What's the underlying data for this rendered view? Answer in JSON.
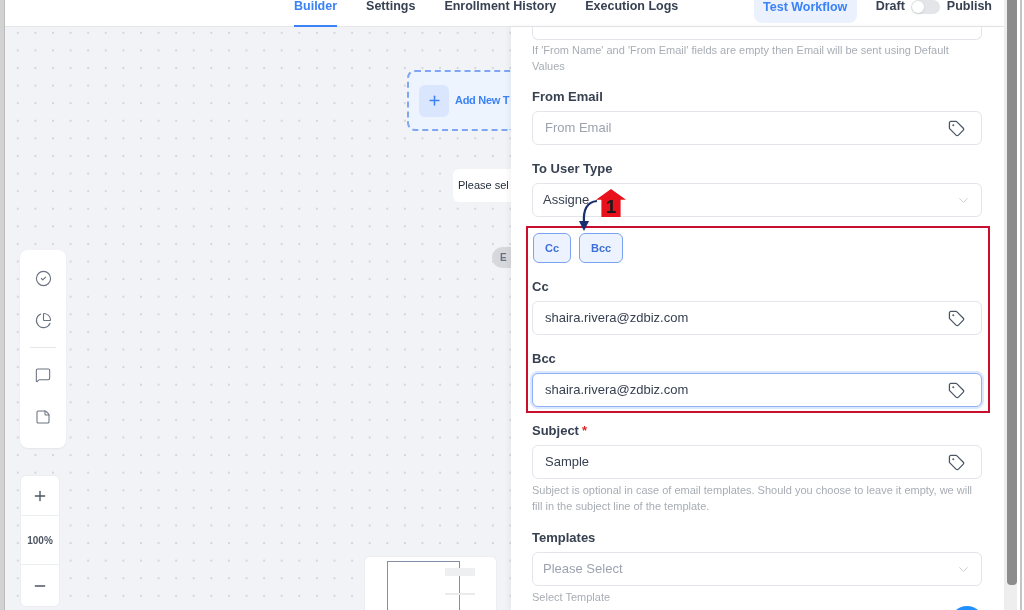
{
  "header": {
    "tabs": [
      {
        "label": "Builder",
        "selected": true
      },
      {
        "label": "Settings",
        "selected": false
      },
      {
        "label": "Enrollment History",
        "selected": false
      },
      {
        "label": "Execution Logs",
        "selected": false
      }
    ],
    "test_button": "Test Workflow",
    "status_switch": {
      "off_label": "Draft",
      "on_label": "Publish",
      "on": false
    }
  },
  "canvas": {
    "nodes": [
      {
        "kind": "add",
        "label": "Add New T"
      },
      {
        "kind": "trigger",
        "label": "Please sel"
      },
      {
        "kind": "end",
        "label": "E"
      }
    ],
    "zoom_level": "100%"
  },
  "panel": {
    "top_hint": "If 'From Name' and 'From Email' fields are empty then Email will be sent using Default Values",
    "fields": [
      {
        "kind": "text",
        "label": "From Email",
        "placeholder": "From Email",
        "focused": false,
        "highlighted": false
      },
      {
        "kind": "select",
        "label": "To User Type",
        "value": "Assigne",
        "highlighted": false
      },
      {
        "kind": "toggles",
        "buttons": [
          {
            "label": "Cc",
            "selected": true
          },
          {
            "label": "Bcc",
            "selected": true
          }
        ],
        "highlighted": true
      },
      {
        "kind": "text",
        "label": "Cc",
        "value": "shaira.rivera@zdbiz.com",
        "focused": false,
        "highlighted": true
      },
      {
        "kind": "text",
        "label": "Bcc",
        "value": "shaira.rivera@zdbiz.com",
        "focused": true,
        "highlighted": true
      },
      {
        "kind": "text",
        "label": "Subject",
        "required_mark": "*",
        "value": "Sample",
        "focused": false,
        "hint": "Subject is optional in case of email templates. Should you choose to leave it empty, we will fill in the subject line of the template.",
        "highlighted": false
      },
      {
        "kind": "select",
        "label": "Templates",
        "placeholder": "Please Select",
        "hint": "Select Template",
        "highlighted": false
      }
    ]
  },
  "callout": {
    "number": "1"
  }
}
